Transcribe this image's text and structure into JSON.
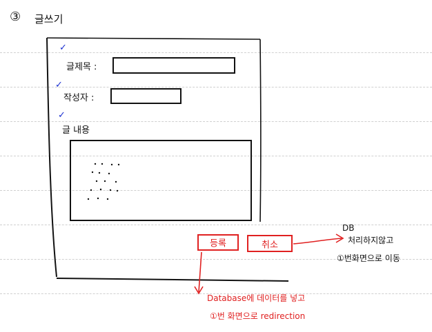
{
  "title": {
    "number": "③",
    "text": "글쓰기"
  },
  "form": {
    "check_mark": "✓",
    "title_label": "글제목 :",
    "author_label": "작성자 :",
    "content_label": "글 내용"
  },
  "buttons": {
    "submit_label": "등록",
    "cancel_label": "취소"
  },
  "annotations": {
    "cancel_note_line1": "DB",
    "cancel_note_line2": "처리하지않고",
    "cancel_note_line3": "①번화면으로 이동",
    "submit_note_line1": "Database에 데이터를 넣고",
    "submit_note_line2": "①번 화면으로 redirection"
  },
  "colors": {
    "ink": "#111111",
    "annotation_red": "#e02020",
    "check_blue": "#1a2fd0",
    "ruled_line": "#cfcfcf"
  }
}
